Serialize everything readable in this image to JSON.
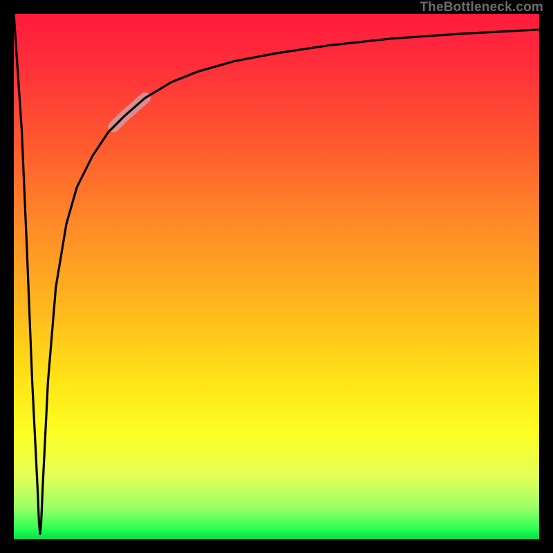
{
  "watermark": "TheBottleneck.com",
  "chart_data": {
    "type": "line",
    "title": "",
    "xlabel": "",
    "ylabel": "",
    "xlim": [
      0,
      100
    ],
    "ylim": [
      0,
      100
    ],
    "gradient_colors": {
      "top": "#ff1a3c",
      "upper_mid": "#ff8a28",
      "mid": "#ffe417",
      "lower_mid": "#e4ff57",
      "bottom": "#00e048"
    },
    "series": [
      {
        "name": "bottleneck-curve",
        "x": [
          0.0,
          1.5,
          2.5,
          3.5,
          4.5,
          4.8,
          5.0,
          5.2,
          5.5,
          6.5,
          8.0,
          10.0,
          12.0,
          15.0,
          18.0,
          21.0,
          25.0,
          30.0,
          35.0,
          42.0,
          50.0,
          60.0,
          72.0,
          85.0,
          100.0
        ],
        "values": [
          100.0,
          78.0,
          55.0,
          30.0,
          10.0,
          3.0,
          1.0,
          3.0,
          10.0,
          30.0,
          48.0,
          60.0,
          67.0,
          73.0,
          77.5,
          80.5,
          84.0,
          87.0,
          89.0,
          91.0,
          92.5,
          94.0,
          95.3,
          96.2,
          97.0
        ]
      }
    ],
    "highlight_segment": {
      "series": "bottleneck-curve",
      "x_start": 19.0,
      "x_end": 25.0,
      "color": "#d49aa0",
      "opacity": 0.85,
      "width": 16
    }
  }
}
